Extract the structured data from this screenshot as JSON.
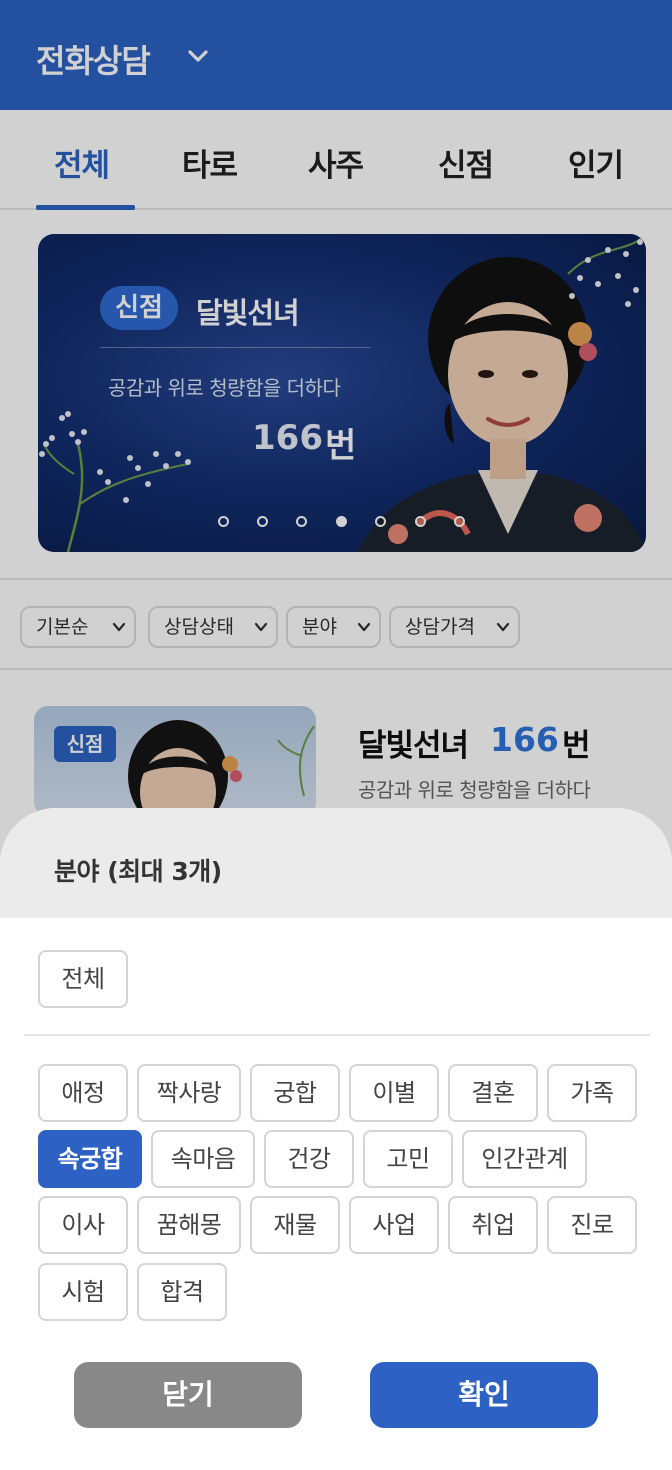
{
  "header": {
    "title": "전화상담",
    "dropdown_icon": "chevron-down-icon"
  },
  "tabs": [
    {
      "label": "전체",
      "active": true
    },
    {
      "label": "타로",
      "active": false
    },
    {
      "label": "사주",
      "active": false
    },
    {
      "label": "신점",
      "active": false
    },
    {
      "label": "인기",
      "active": false
    }
  ],
  "banner": {
    "badge": "신점",
    "name": "달빛선녀",
    "description": "공감과 위로 청량함을 더하다",
    "number": "166",
    "number_unit": "번",
    "carousel_total": 7,
    "carousel_active_index": 3
  },
  "filters": [
    {
      "label": "기본순"
    },
    {
      "label": "상담상태"
    },
    {
      "label": "분야"
    },
    {
      "label": "상담가격"
    }
  ],
  "card": {
    "badge": "신점",
    "name": "달빛선녀",
    "number": "166",
    "number_unit": "번",
    "description": "공감과 위로 청량함을 더하다"
  },
  "sheet": {
    "title": "분야 (최대 3개)",
    "all_label": "전체",
    "options": [
      "애정",
      "짝사랑",
      "궁합",
      "이별",
      "결혼",
      "가족",
      "속궁합",
      "속마음",
      "건강",
      "고민",
      "인간관계",
      "이사",
      "꿈해몽",
      "재물",
      "사업",
      "취업",
      "진로",
      "시험",
      "합격"
    ],
    "selected": [
      "속궁합"
    ],
    "close_label": "닫기",
    "confirm_label": "확인"
  },
  "colors": {
    "primary": "#2d62c4",
    "accent_number": "#2f74d8",
    "close_button": "#888888"
  }
}
